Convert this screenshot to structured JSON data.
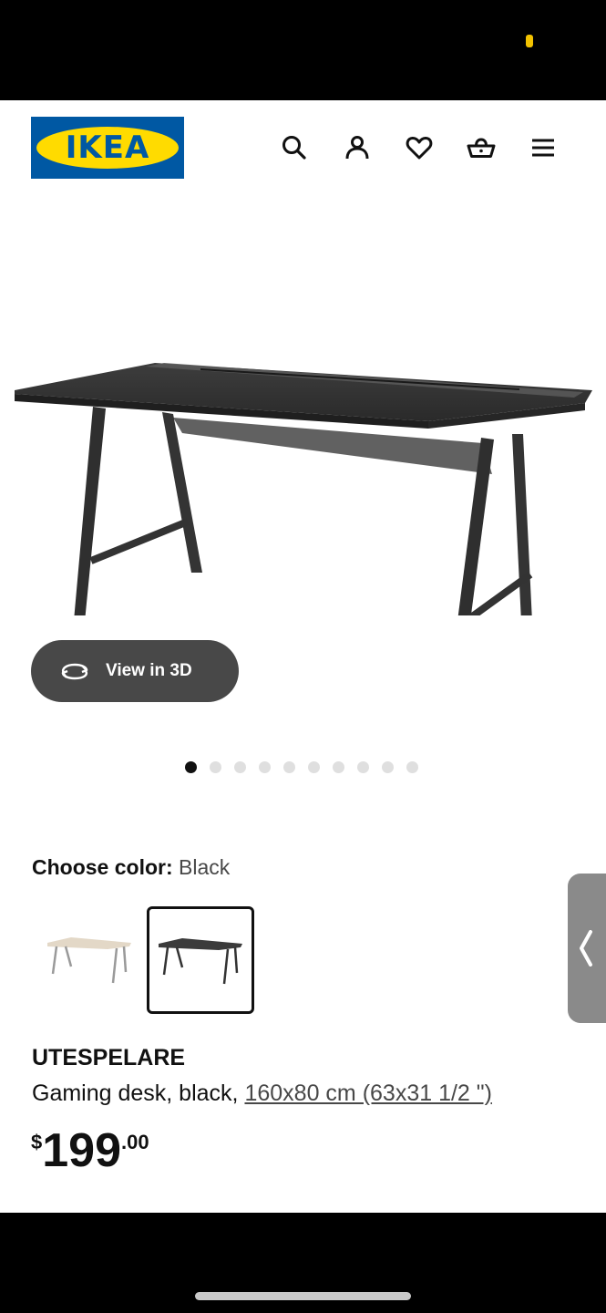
{
  "header": {
    "logo_text": "IKEA",
    "icons": [
      "search-icon",
      "account-icon",
      "wishlist-heart-icon",
      "cart-basket-icon",
      "menu-icon"
    ]
  },
  "gallery": {
    "view_3d_label": "View in 3D",
    "image_count": 10,
    "active_index": 0
  },
  "color_picker": {
    "label": "Choose color:",
    "selected_value": "Black",
    "options": [
      "white-stain",
      "black"
    ]
  },
  "product": {
    "name": "UTESPELARE",
    "description": "Gaming desk, black,",
    "dimensions": "160x80 cm (63x31 1/2 \")",
    "price_currency": "$",
    "price_whole": "199",
    "price_cents": ".00"
  },
  "colors": {
    "ikea_blue": "#0058a3",
    "ikea_yellow": "#ffdb00",
    "button_dark": "#484848"
  }
}
